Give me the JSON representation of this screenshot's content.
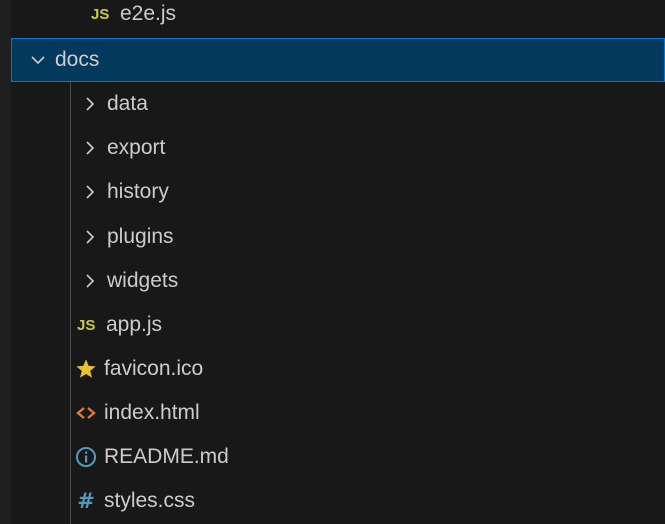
{
  "explorer": {
    "items": [
      {
        "label": "e2e.js",
        "icon": "js-icon"
      },
      {
        "label": "docs",
        "icon": "chevron-down-icon",
        "selected": true
      },
      {
        "label": "data",
        "icon": "chevron-right-icon"
      },
      {
        "label": "export",
        "icon": "chevron-right-icon"
      },
      {
        "label": "history",
        "icon": "chevron-right-icon"
      },
      {
        "label": "plugins",
        "icon": "chevron-right-icon"
      },
      {
        "label": "widgets",
        "icon": "chevron-right-icon"
      },
      {
        "label": "app.js",
        "icon": "js-icon"
      },
      {
        "label": "favicon.ico",
        "icon": "star-icon"
      },
      {
        "label": "index.html",
        "icon": "html-icon"
      },
      {
        "label": "README.md",
        "icon": "info-icon"
      },
      {
        "label": "styles.css",
        "icon": "hash-icon"
      }
    ],
    "icon_glyphs": {
      "js": "JS",
      "hash": "#"
    },
    "colors": {
      "background": "#181818",
      "selection": "#04395e",
      "selection_border": "#0078d4",
      "js": "#cbcb41",
      "star": "#e8c32c",
      "html": "#e37933",
      "info": "#519aba",
      "css": "#519aba"
    }
  }
}
